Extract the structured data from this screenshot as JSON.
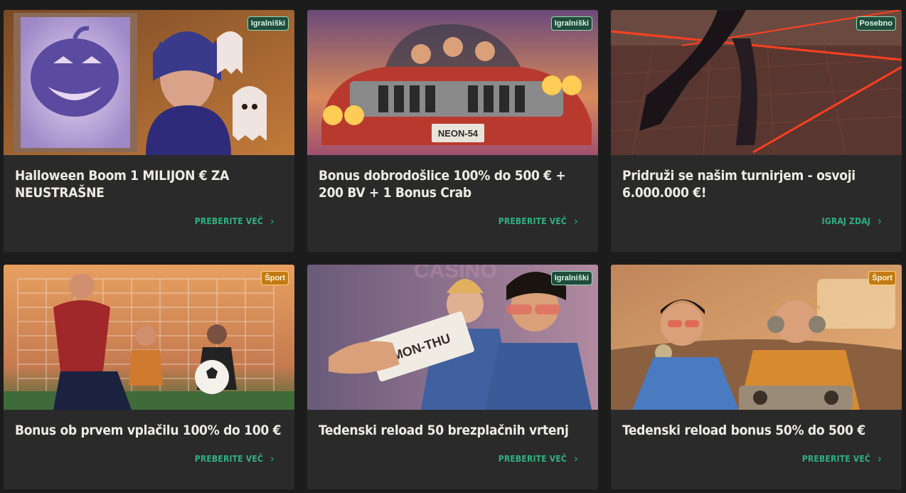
{
  "promos": [
    {
      "title": "Halloween Boom 1 MILIJON € ZA NEUSTRAŠNE",
      "badge": "Igralniški",
      "badge_type": "casino",
      "cta": "PREBERITE VEČ"
    },
    {
      "title": "Bonus dobrodošlice 100% do 500 € + 200 BV + 1 Bonus Crab",
      "badge": "Igralniški",
      "badge_type": "casino",
      "cta": "PREBERITE VEČ",
      "plate": "NEON-54"
    },
    {
      "title": "Pridruži se našim turnirjem - osvoji 6.000.000 €!",
      "badge": "Posebno",
      "badge_type": "special",
      "cta": "IGRAJ ZDAJ"
    },
    {
      "title": "Bonus ob prvem vplačilu 100% do 100 €",
      "badge": "Šport",
      "badge_type": "sport",
      "cta": "PREBERITE VEČ"
    },
    {
      "title": "Tedenski reload 50 brezplačnih vrtenj",
      "badge": "Igralniški",
      "badge_type": "casino",
      "cta": "PREBERITE VEČ",
      "ticket": "MON-THU",
      "sign": "CASINO"
    },
    {
      "title": "Tedenski reload bonus 50% do 500 €",
      "badge": "Šport",
      "badge_type": "sport",
      "cta": "PREBERITE VEČ"
    }
  ],
  "colors": {
    "background": "#1c1c1c",
    "card": "#2a2a2a",
    "accent": "#2fb083",
    "title": "#ecebe7"
  },
  "icons": {
    "cta_arrow": "chevron-right-icon"
  }
}
